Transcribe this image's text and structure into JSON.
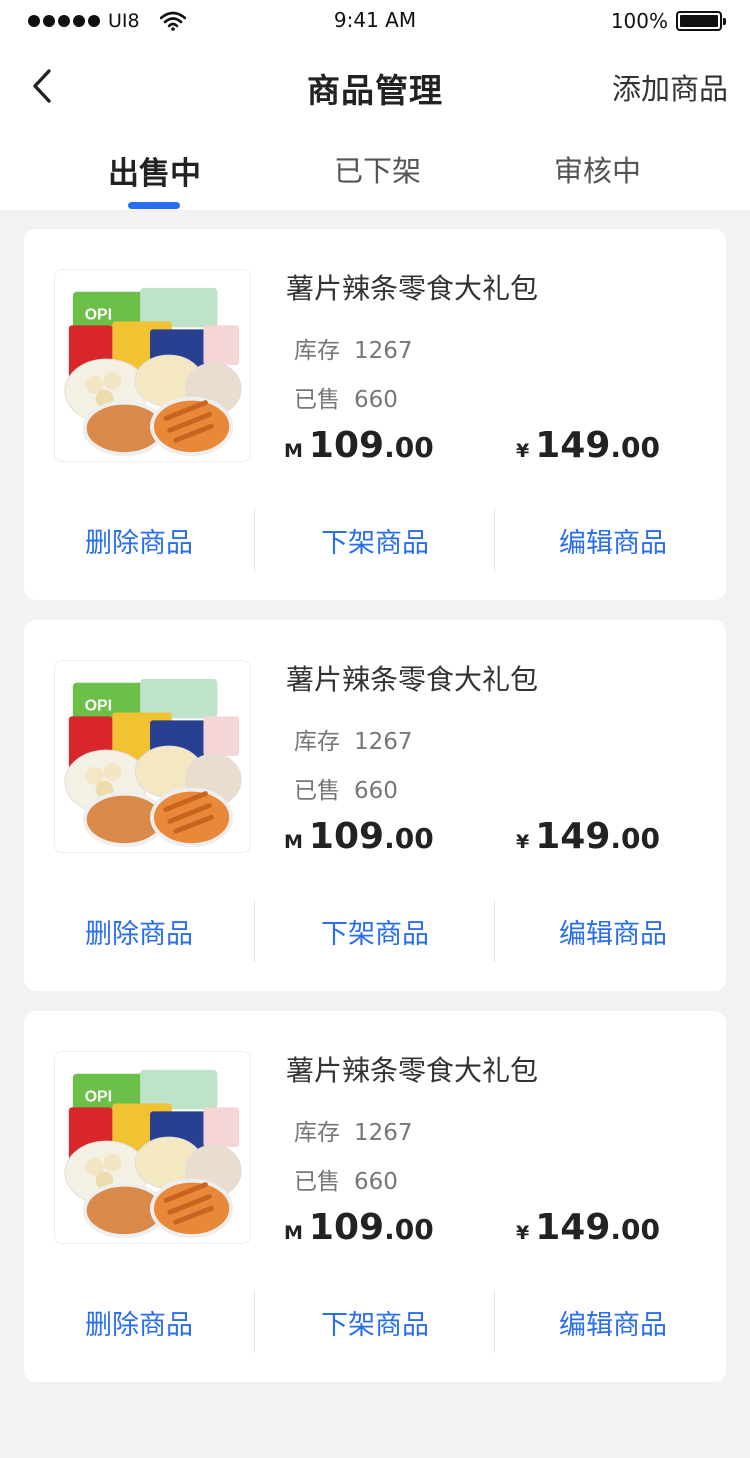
{
  "status_bar": {
    "carrier": "UI8",
    "time": "9:41 AM",
    "battery": "100%",
    "battery_level": 1.0
  },
  "nav": {
    "back_icon": "chevron-left-icon",
    "title": "商品管理",
    "action_label": "添加商品"
  },
  "tabs": [
    {
      "label": "出售中",
      "active": true
    },
    {
      "label": "已下架",
      "active": false
    },
    {
      "label": "审核中",
      "active": false
    }
  ],
  "colors": {
    "accent": "#2a6ef0",
    "background": "#f2f2f2",
    "card": "#ffffff"
  },
  "products": [
    {
      "name": "薯片辣条零食大礼包",
      "stock_label": "库存",
      "stock_value": "1267",
      "sold_label": "已售",
      "sold_value": "660",
      "price1_currency": "M",
      "price1_int": "109",
      "price1_dec": ".00",
      "price2_currency": "¥",
      "price2_int": "149",
      "price2_dec": ".00",
      "actions": [
        "删除商品",
        "下架商品",
        "编辑商品"
      ]
    },
    {
      "name": "薯片辣条零食大礼包",
      "stock_label": "库存",
      "stock_value": "1267",
      "sold_label": "已售",
      "sold_value": "660",
      "price1_currency": "M",
      "price1_int": "109",
      "price1_dec": ".00",
      "price2_currency": "¥",
      "price2_int": "149",
      "price2_dec": ".00",
      "actions": [
        "删除商品",
        "下架商品",
        "编辑商品"
      ]
    },
    {
      "name": "薯片辣条零食大礼包",
      "stock_label": "库存",
      "stock_value": "1267",
      "sold_label": "已售",
      "sold_value": "660",
      "price1_currency": "M",
      "price1_int": "109",
      "price1_dec": ".00",
      "price2_currency": "¥",
      "price2_int": "149",
      "price2_dec": ".00",
      "actions": [
        "删除商品",
        "下架商品",
        "编辑商品"
      ]
    }
  ]
}
